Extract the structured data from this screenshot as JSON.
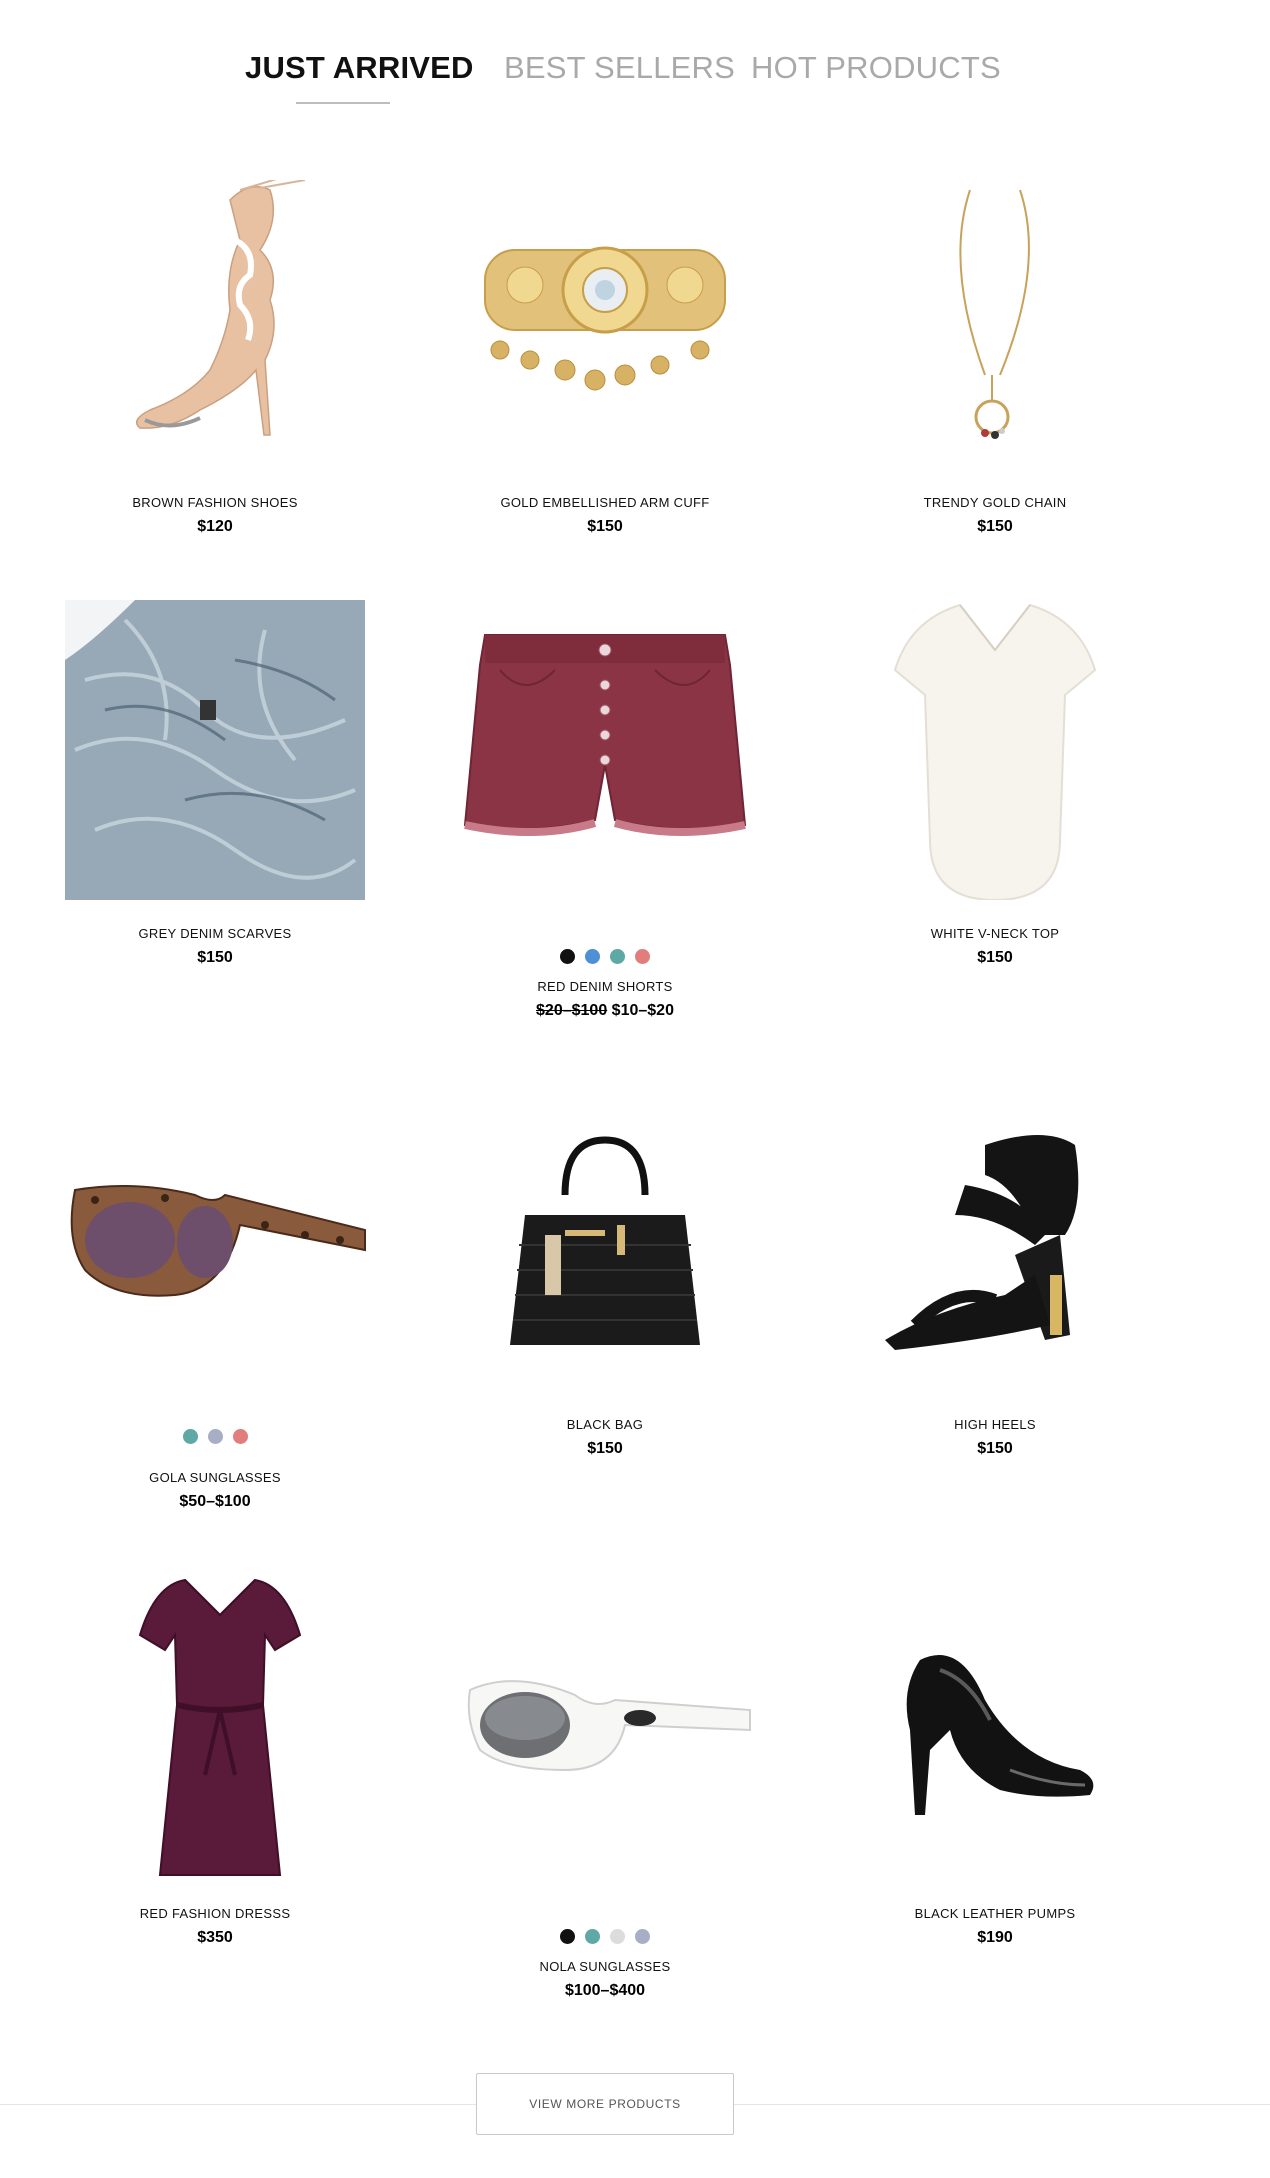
{
  "tabs": [
    {
      "label": "JUST ARRIVED",
      "active": true
    },
    {
      "label": "BEST SELLERS",
      "active": false
    },
    {
      "label": "HOT PRODUCTS",
      "active": false
    }
  ],
  "products": [
    {
      "name": "BROWN FASHION SHOES",
      "price": "$120"
    },
    {
      "name": "GOLD EMBELLISHED ARM CUFF",
      "price": "$150"
    },
    {
      "name": "TRENDY GOLD CHAIN",
      "price": "$150"
    },
    {
      "name": "GREY DENIM SCARVES",
      "price": "$150"
    },
    {
      "name": "RED DENIM SHORTS",
      "old_price": "$20–$100",
      "price": "$10–$20",
      "swatches": [
        "#111111",
        "#4f8fd6",
        "#5ea8a6",
        "#e27d7d"
      ]
    },
    {
      "name": "WHITE V-NECK TOP",
      "price": "$150"
    },
    {
      "name": "GOLA SUNGLASSES",
      "price": "$50–$100",
      "swatches": [
        "#5ea8a6",
        "#a7aec6",
        "#e27d7d"
      ]
    },
    {
      "name": "BLACK BAG",
      "price": "$150"
    },
    {
      "name": "HIGH HEELS",
      "price": "$150"
    },
    {
      "name": "RED FASHION DRESSS",
      "price": "$350"
    },
    {
      "name": "NOLA SUNGLASSES",
      "price": "$100–$400",
      "swatches": [
        "#111111",
        "#5ea8a6",
        "#dcdcdc",
        "#a7aec6"
      ]
    },
    {
      "name": "BLACK LEATHER PUMPS",
      "price": "$190"
    }
  ],
  "view_more_label": "VIEW MORE PRODUCTS",
  "colors": {
    "active_tab": "#111111",
    "inactive_tab": "#a9a9a9",
    "border": "#c9c9c9"
  }
}
